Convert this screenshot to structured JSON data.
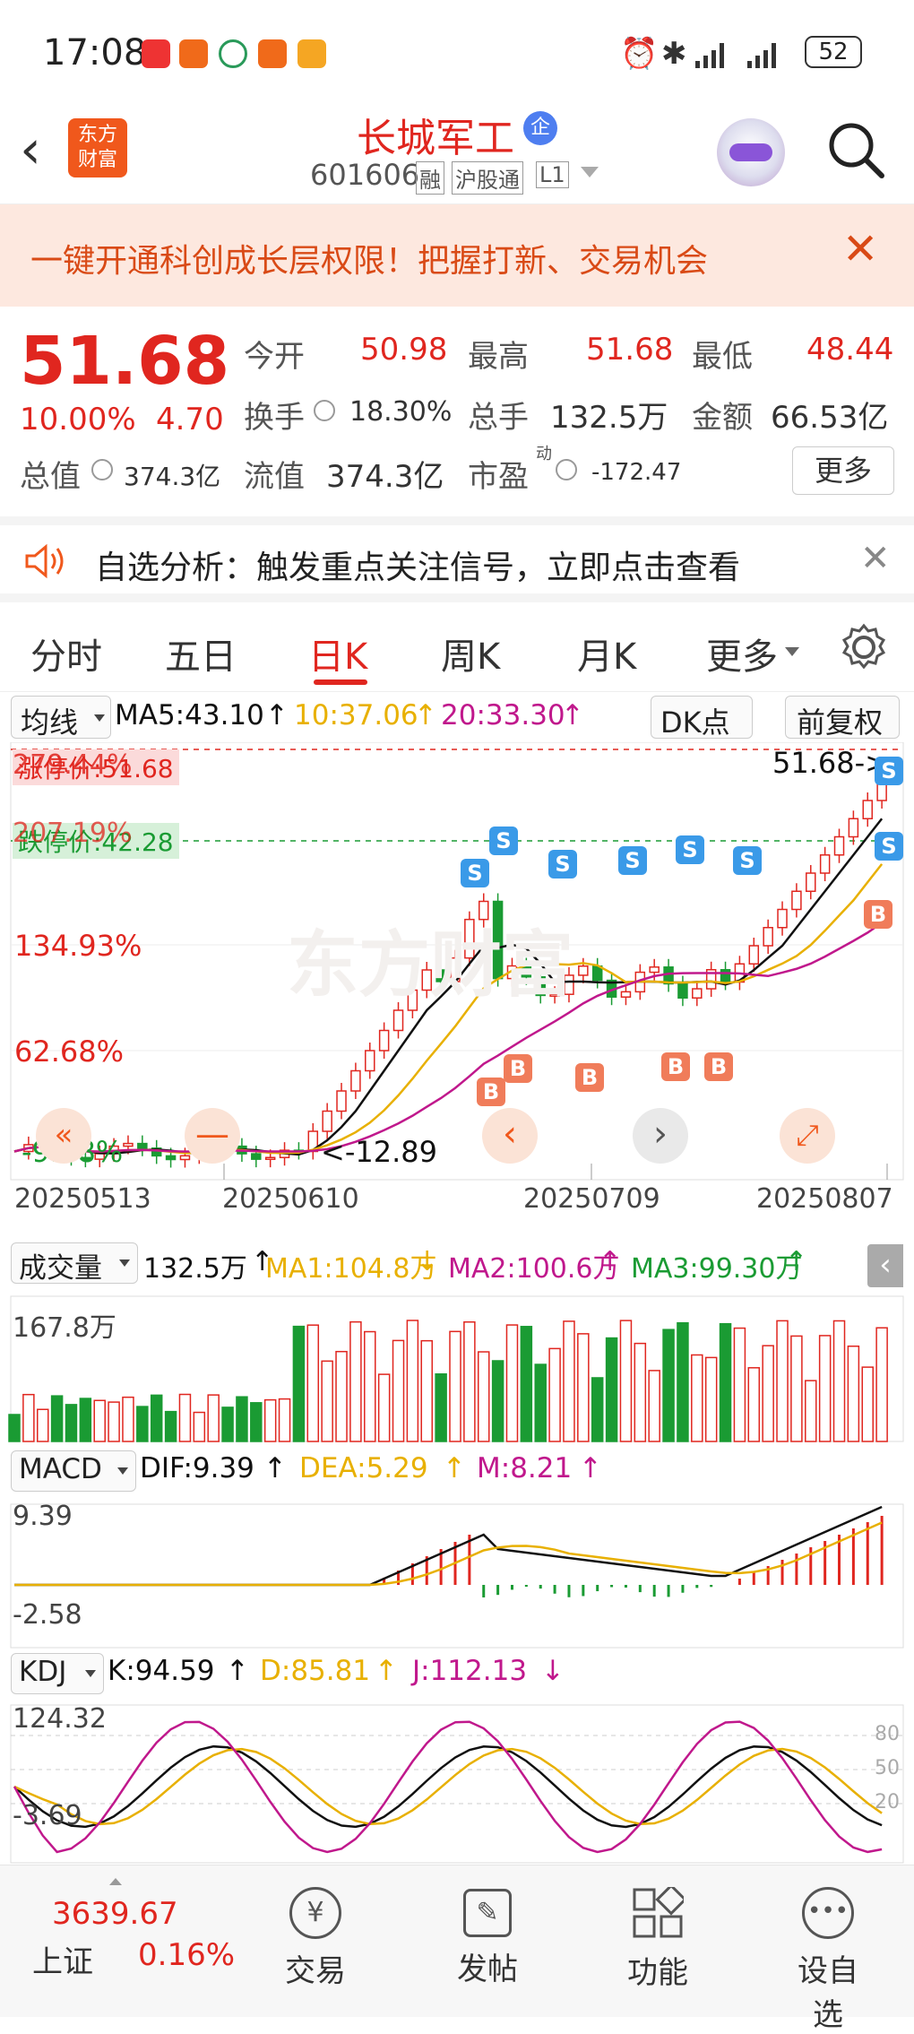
{
  "status": {
    "time": "17:08",
    "battery": "52"
  },
  "nav": {
    "logo_line1": "东方",
    "logo_line2": "财富",
    "title": "长城军工",
    "badge": "企",
    "code": "601606",
    "tag1": "融",
    "tag2": "沪股通",
    "tag3": "L1"
  },
  "banner": {
    "text": "一键开通科创成长层权限！把握打新、交易机会"
  },
  "quote": {
    "price": "51.68",
    "change_pct": "10.00%",
    "change": "4.70",
    "open_label": "今开",
    "open": "50.98",
    "high_label": "最高",
    "high": "51.68",
    "low_label": "最低",
    "low": "48.44",
    "turnover_label": "换手",
    "turnover": "18.30%",
    "volume_label": "总手",
    "volume": "132.5万",
    "amount_label": "金额",
    "amount": "66.53亿",
    "mktcap_label": "总值",
    "mktcap": "374.3亿",
    "float_label": "流值",
    "float": "374.3亿",
    "pe_label": "市盈",
    "pe_sup": "动",
    "pe": "-172.47",
    "more": "更多"
  },
  "alert": {
    "text": "自选分析：触发重点关注信号，立即点击查看"
  },
  "tabs": [
    "分时",
    "五日",
    "日K",
    "周K",
    "月K",
    "更多"
  ],
  "kline": {
    "ma_label": "均线",
    "ma5": "MA5:43.10",
    "ma10": "10:37.06",
    "ma20": "20:33.30",
    "dk": "DK点",
    "fq": "前复权",
    "y_top": "279.44%",
    "limit_up_text": "涨停价:51.68",
    "y2": "207.19%",
    "limit_down_text": "跌停价:42.28",
    "y3": "134.93%",
    "y4": "62.68%",
    "y5": "-9.58%",
    "last_price": "51.68->",
    "min_label": "<-12.89",
    "dates": [
      "20250513",
      "20250610",
      "20250709",
      "20250807"
    ],
    "watermark": "东方财富"
  },
  "vol": {
    "label": "成交量",
    "value": "132.5万",
    "ma1": "MA1:104.8万",
    "ma2": "MA2:100.6万",
    "ma3": "MA3:99.30万",
    "max": "167.8万"
  },
  "macd": {
    "label": "MACD",
    "dif": "DIF:9.39",
    "dea": "DEA:5.29",
    "m": "M:8.21",
    "max": "9.39",
    "min": "-2.58"
  },
  "kdj": {
    "label": "KDJ",
    "k": "K:94.59",
    "d": "D:85.81",
    "j": "J:112.13",
    "max": "124.32",
    "min": "-3.69",
    "l80": "80",
    "l50": "50",
    "l20": "20"
  },
  "bottom": {
    "index_value": "3639.67",
    "index_name": "上证",
    "index_change": "0.16%",
    "b1": "交易",
    "b2": "发帖",
    "b3": "功能",
    "b4": "设自选"
  },
  "colors": {
    "up": "#e0261f",
    "down": "#1a9b33",
    "ma5": "#111111",
    "ma10": "#e8b000",
    "ma20": "#c0188c"
  }
}
